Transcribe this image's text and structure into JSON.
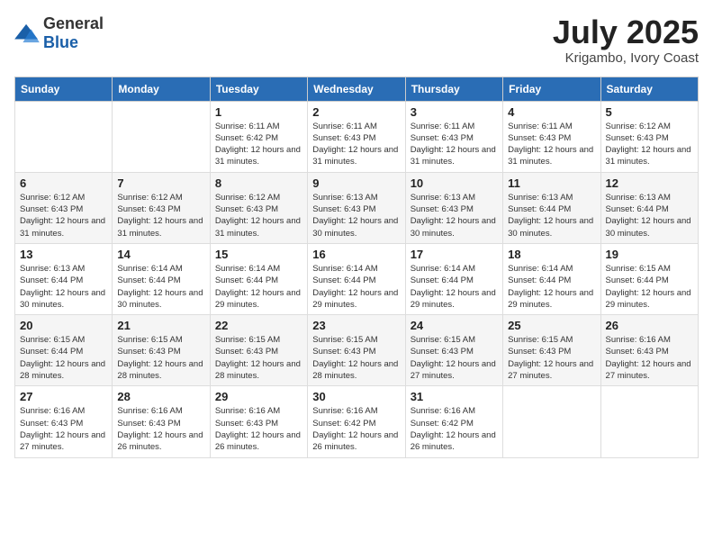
{
  "logo": {
    "general": "General",
    "blue": "Blue"
  },
  "header": {
    "month": "July 2025",
    "location": "Krigambo, Ivory Coast"
  },
  "weekdays": [
    "Sunday",
    "Monday",
    "Tuesday",
    "Wednesday",
    "Thursday",
    "Friday",
    "Saturday"
  ],
  "weeks": [
    [
      {
        "day": "",
        "sunrise": "",
        "sunset": "",
        "daylight": ""
      },
      {
        "day": "",
        "sunrise": "",
        "sunset": "",
        "daylight": ""
      },
      {
        "day": "1",
        "sunrise": "Sunrise: 6:11 AM",
        "sunset": "Sunset: 6:42 PM",
        "daylight": "Daylight: 12 hours and 31 minutes."
      },
      {
        "day": "2",
        "sunrise": "Sunrise: 6:11 AM",
        "sunset": "Sunset: 6:43 PM",
        "daylight": "Daylight: 12 hours and 31 minutes."
      },
      {
        "day": "3",
        "sunrise": "Sunrise: 6:11 AM",
        "sunset": "Sunset: 6:43 PM",
        "daylight": "Daylight: 12 hours and 31 minutes."
      },
      {
        "day": "4",
        "sunrise": "Sunrise: 6:11 AM",
        "sunset": "Sunset: 6:43 PM",
        "daylight": "Daylight: 12 hours and 31 minutes."
      },
      {
        "day": "5",
        "sunrise": "Sunrise: 6:12 AM",
        "sunset": "Sunset: 6:43 PM",
        "daylight": "Daylight: 12 hours and 31 minutes."
      }
    ],
    [
      {
        "day": "6",
        "sunrise": "Sunrise: 6:12 AM",
        "sunset": "Sunset: 6:43 PM",
        "daylight": "Daylight: 12 hours and 31 minutes."
      },
      {
        "day": "7",
        "sunrise": "Sunrise: 6:12 AM",
        "sunset": "Sunset: 6:43 PM",
        "daylight": "Daylight: 12 hours and 31 minutes."
      },
      {
        "day": "8",
        "sunrise": "Sunrise: 6:12 AM",
        "sunset": "Sunset: 6:43 PM",
        "daylight": "Daylight: 12 hours and 31 minutes."
      },
      {
        "day": "9",
        "sunrise": "Sunrise: 6:13 AM",
        "sunset": "Sunset: 6:43 PM",
        "daylight": "Daylight: 12 hours and 30 minutes."
      },
      {
        "day": "10",
        "sunrise": "Sunrise: 6:13 AM",
        "sunset": "Sunset: 6:43 PM",
        "daylight": "Daylight: 12 hours and 30 minutes."
      },
      {
        "day": "11",
        "sunrise": "Sunrise: 6:13 AM",
        "sunset": "Sunset: 6:44 PM",
        "daylight": "Daylight: 12 hours and 30 minutes."
      },
      {
        "day": "12",
        "sunrise": "Sunrise: 6:13 AM",
        "sunset": "Sunset: 6:44 PM",
        "daylight": "Daylight: 12 hours and 30 minutes."
      }
    ],
    [
      {
        "day": "13",
        "sunrise": "Sunrise: 6:13 AM",
        "sunset": "Sunset: 6:44 PM",
        "daylight": "Daylight: 12 hours and 30 minutes."
      },
      {
        "day": "14",
        "sunrise": "Sunrise: 6:14 AM",
        "sunset": "Sunset: 6:44 PM",
        "daylight": "Daylight: 12 hours and 30 minutes."
      },
      {
        "day": "15",
        "sunrise": "Sunrise: 6:14 AM",
        "sunset": "Sunset: 6:44 PM",
        "daylight": "Daylight: 12 hours and 29 minutes."
      },
      {
        "day": "16",
        "sunrise": "Sunrise: 6:14 AM",
        "sunset": "Sunset: 6:44 PM",
        "daylight": "Daylight: 12 hours and 29 minutes."
      },
      {
        "day": "17",
        "sunrise": "Sunrise: 6:14 AM",
        "sunset": "Sunset: 6:44 PM",
        "daylight": "Daylight: 12 hours and 29 minutes."
      },
      {
        "day": "18",
        "sunrise": "Sunrise: 6:14 AM",
        "sunset": "Sunset: 6:44 PM",
        "daylight": "Daylight: 12 hours and 29 minutes."
      },
      {
        "day": "19",
        "sunrise": "Sunrise: 6:15 AM",
        "sunset": "Sunset: 6:44 PM",
        "daylight": "Daylight: 12 hours and 29 minutes."
      }
    ],
    [
      {
        "day": "20",
        "sunrise": "Sunrise: 6:15 AM",
        "sunset": "Sunset: 6:44 PM",
        "daylight": "Daylight: 12 hours and 28 minutes."
      },
      {
        "day": "21",
        "sunrise": "Sunrise: 6:15 AM",
        "sunset": "Sunset: 6:43 PM",
        "daylight": "Daylight: 12 hours and 28 minutes."
      },
      {
        "day": "22",
        "sunrise": "Sunrise: 6:15 AM",
        "sunset": "Sunset: 6:43 PM",
        "daylight": "Daylight: 12 hours and 28 minutes."
      },
      {
        "day": "23",
        "sunrise": "Sunrise: 6:15 AM",
        "sunset": "Sunset: 6:43 PM",
        "daylight": "Daylight: 12 hours and 28 minutes."
      },
      {
        "day": "24",
        "sunrise": "Sunrise: 6:15 AM",
        "sunset": "Sunset: 6:43 PM",
        "daylight": "Daylight: 12 hours and 27 minutes."
      },
      {
        "day": "25",
        "sunrise": "Sunrise: 6:15 AM",
        "sunset": "Sunset: 6:43 PM",
        "daylight": "Daylight: 12 hours and 27 minutes."
      },
      {
        "day": "26",
        "sunrise": "Sunrise: 6:16 AM",
        "sunset": "Sunset: 6:43 PM",
        "daylight": "Daylight: 12 hours and 27 minutes."
      }
    ],
    [
      {
        "day": "27",
        "sunrise": "Sunrise: 6:16 AM",
        "sunset": "Sunset: 6:43 PM",
        "daylight": "Daylight: 12 hours and 27 minutes."
      },
      {
        "day": "28",
        "sunrise": "Sunrise: 6:16 AM",
        "sunset": "Sunset: 6:43 PM",
        "daylight": "Daylight: 12 hours and 26 minutes."
      },
      {
        "day": "29",
        "sunrise": "Sunrise: 6:16 AM",
        "sunset": "Sunset: 6:43 PM",
        "daylight": "Daylight: 12 hours and 26 minutes."
      },
      {
        "day": "30",
        "sunrise": "Sunrise: 6:16 AM",
        "sunset": "Sunset: 6:42 PM",
        "daylight": "Daylight: 12 hours and 26 minutes."
      },
      {
        "day": "31",
        "sunrise": "Sunrise: 6:16 AM",
        "sunset": "Sunset: 6:42 PM",
        "daylight": "Daylight: 12 hours and 26 minutes."
      },
      {
        "day": "",
        "sunrise": "",
        "sunset": "",
        "daylight": ""
      },
      {
        "day": "",
        "sunrise": "",
        "sunset": "",
        "daylight": ""
      }
    ]
  ]
}
